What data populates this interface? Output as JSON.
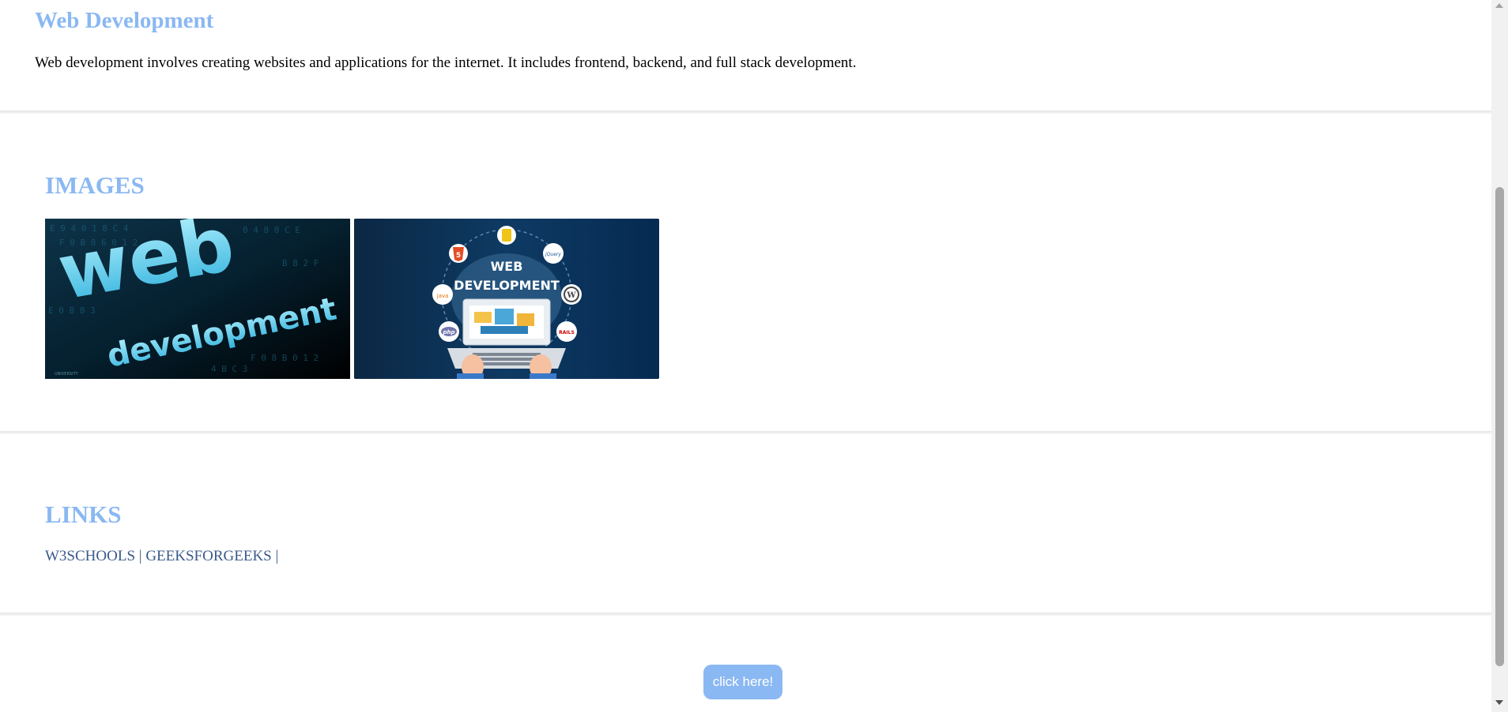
{
  "intro": {
    "title": "Web Development",
    "text": "Web development involves creating websites and applications for the internet. It includes frontend, backend, and full stack development."
  },
  "images_section": {
    "title": "IMAGES",
    "images": [
      {
        "name": "web-development-text-image",
        "big_word": "web",
        "small_word": "development",
        "corner_text": "UNIVERSITY"
      },
      {
        "name": "web-development-illustration-image",
        "line1": "WEB",
        "line2": "DEVELOPMENT",
        "badge_html5": "5",
        "badge_php": "php",
        "badge_jquery": "jQuery",
        "badge_rails": "RAILS",
        "badge_java": "java"
      }
    ]
  },
  "links_section": {
    "title": "LINKS",
    "links": [
      {
        "label": "W3SCHOOLS"
      },
      {
        "label": "GEEKSFORGEEKS"
      }
    ],
    "separator": "|"
  },
  "button": {
    "label": "click here!"
  },
  "colors": {
    "accent": "#8ab8f2",
    "link": "#3a5a8a"
  }
}
